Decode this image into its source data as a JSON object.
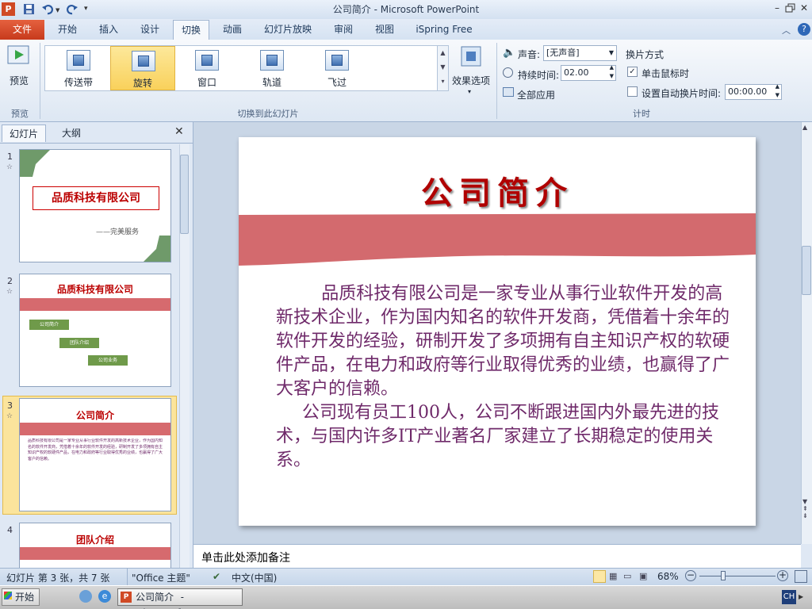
{
  "window": {
    "title": "公司简介 - Microsoft PowerPoint"
  },
  "tabs": {
    "file": "文件",
    "items": [
      "开始",
      "插入",
      "设计",
      "切换",
      "动画",
      "幻灯片放映",
      "审阅",
      "视图",
      "iSpring Free"
    ],
    "active_index": 3
  },
  "ribbon": {
    "preview": {
      "label": "预览",
      "group": "预览"
    },
    "gallery": [
      {
        "label": "传送带",
        "selected": false
      },
      {
        "label": "旋转",
        "selected": true
      },
      {
        "label": "窗口",
        "selected": false
      },
      {
        "label": "轨道",
        "selected": false
      },
      {
        "label": "飞过",
        "selected": false
      }
    ],
    "effect_options": "效果选项",
    "transition_group": "切换到此幻灯片",
    "timing": {
      "sound_label": "声音:",
      "sound_value": "[无声音]",
      "duration_label": "持续时间:",
      "duration_value": "02.00",
      "apply_all": "全部应用",
      "advance_title": "换片方式",
      "on_click": "单击鼠标时",
      "on_click_checked": true,
      "auto_after": "设置自动换片时间:",
      "auto_after_checked": false,
      "auto_value": "00:00.00",
      "group": "计时"
    }
  },
  "pane": {
    "tabs": [
      "幻灯片",
      "大纲"
    ],
    "thumbnails": [
      {
        "num": "1",
        "title": "品质科技有限公司",
        "subtitle": "——完美服务"
      },
      {
        "num": "2",
        "title": "品质科技有限公司",
        "items": [
          "公司简介",
          "团队介绍",
          "公司业务"
        ]
      },
      {
        "num": "3",
        "title": "公司简介",
        "selected": true
      },
      {
        "num": "4",
        "title": "团队介绍"
      }
    ]
  },
  "slide": {
    "title": "公司简介",
    "paragraphs": [
      "品质科技有限公司是一家专业从事行业软件开发的高新技术企业，作为国内知名的软件开发商，凭借着十余年的软件开发的经验，研制开发了多项拥有自主知识产权的软硬件产品，在电力和政府等行业取得优秀的业绩，也赢得了广大客户的信赖。",
      "公司现有员工100人，公司不断跟进国内外最先进的技术，与国内许多IT产业著名厂家建立了长期稳定的使用关系。"
    ]
  },
  "notes": {
    "placeholder": "单击此处添加备注"
  },
  "status": {
    "slide_info": "幻灯片 第 3 张，共 7 张",
    "theme": "\"Office 主题\"",
    "language": "中文(中国)",
    "zoom": "68%"
  },
  "taskbar": {
    "start": "开始",
    "task": "公司简介 - Microsof...",
    "ime": "CH"
  }
}
